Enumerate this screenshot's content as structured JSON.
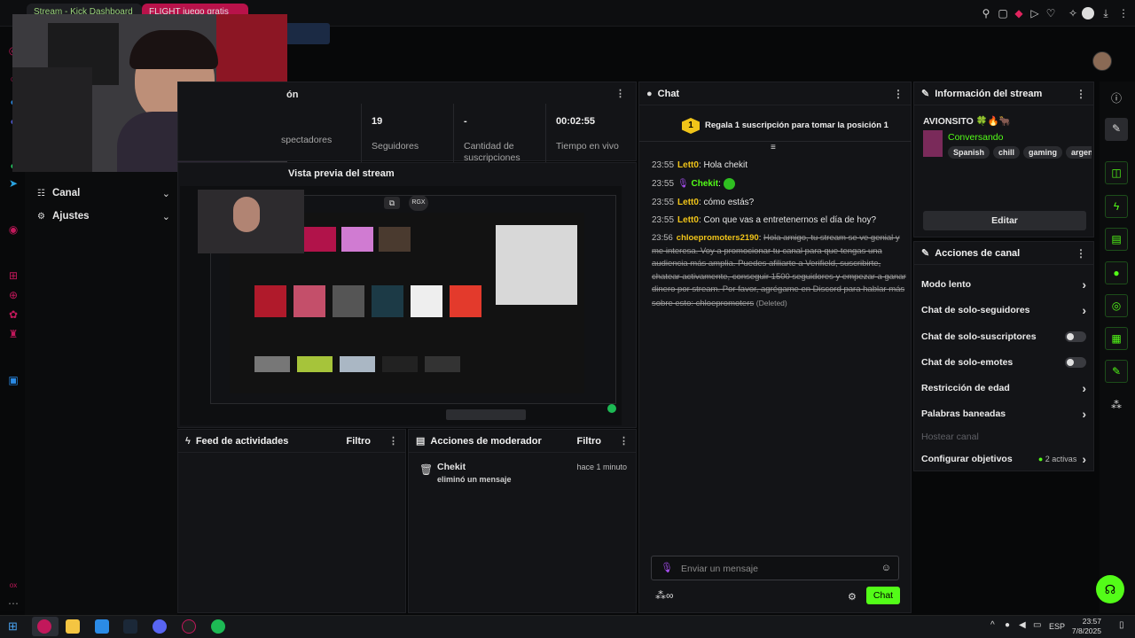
{
  "browser": {
    "tabs": [
      {
        "label": "Stream - Kick Dashboard"
      },
      {
        "label": "FLIGHT juego gratis"
      }
    ]
  },
  "sidebar": {
    "items": [
      {
        "label": "Canal"
      },
      {
        "label": "Ajustes"
      }
    ]
  },
  "stats": {
    "header_fragment": "ón",
    "items": [
      {
        "value": "",
        "label": "Espectadores",
        "shown": "spectadores"
      },
      {
        "value": "19",
        "label": "Seguidores"
      },
      {
        "value": "-",
        "label": "Cantidad de suscripciones"
      },
      {
        "value": "00:02:55",
        "label": "Tiempo en vivo"
      }
    ]
  },
  "preview": {
    "title": "Vista previa del stream",
    "overlay_label": "RGX"
  },
  "activity": {
    "title": "Feed de actividades",
    "filter": "Filtro"
  },
  "moderator": {
    "title": "Acciones de moderador",
    "filter": "Filtro",
    "entries": [
      {
        "user": "Chekit",
        "action": "eliminó un mensaje",
        "time": "hace 1 minuto"
      }
    ]
  },
  "chat": {
    "title": "Chat",
    "banner_rank": "1",
    "banner": "Regala 1 suscripción para tomar la posición 1",
    "messages": [
      {
        "time": "23:55",
        "user": "Lett0",
        "text": "Hola chekit"
      },
      {
        "time": "23:55",
        "user": "Chekit",
        "text": ""
      },
      {
        "time": "23:55",
        "user": "Lett0",
        "text": "cómo estás?"
      },
      {
        "time": "23:55",
        "user": "Lett0",
        "text": "Con que vas a entretenernos el día de hoy?"
      },
      {
        "time": "23:56",
        "user": "chloepromoters2190",
        "text": "Hola amigo, tu stream se ve genial y me interesa. Voy a promocionar tu canal para que tengas una audiencia más amplia. Puedes afiliarte a Verifield, suscribirte, chatear activamente, conseguir 1500 seguidores y empezar a ganar dinero por stream. Por favor, agrégame en Discord para hablar más sobre esto: chloepromoters",
        "deleted": "(Deleted)"
      }
    ],
    "input_placeholder": "Enviar un mensaje",
    "send_label": "Chat"
  },
  "stream_info": {
    "title": "Información del stream",
    "stream_title": "AVIONSITO 🍀🔥🐂",
    "category": "Conversando",
    "tags": [
      "Spanish",
      "chill",
      "gaming",
      "argenti"
    ],
    "edit_label": "Editar"
  },
  "channel_actions": {
    "title": "Acciones de canal",
    "items": [
      {
        "label": "Modo lento",
        "control": "chevron"
      },
      {
        "label": "Chat de solo-seguidores",
        "control": "chevron"
      },
      {
        "label": "Chat de solo-suscriptores",
        "control": "toggle",
        "enabled": false
      },
      {
        "label": "Chat de solo-emotes",
        "control": "toggle",
        "enabled": false
      },
      {
        "label": "Restricción de edad",
        "control": "chevron"
      },
      {
        "label": "Palabras baneadas",
        "control": "chevron"
      },
      {
        "label": "Hostear canal",
        "control": "disabled"
      },
      {
        "label": "Configurar objetivos",
        "control": "chevron",
        "badge": "2 activas"
      }
    ]
  },
  "taskbar": {
    "lang": "ESP",
    "time": "23:57",
    "date": "7/8/2025"
  },
  "colors": {
    "accent": "#53fc18",
    "panel": "#131417",
    "bg": "#070809"
  }
}
